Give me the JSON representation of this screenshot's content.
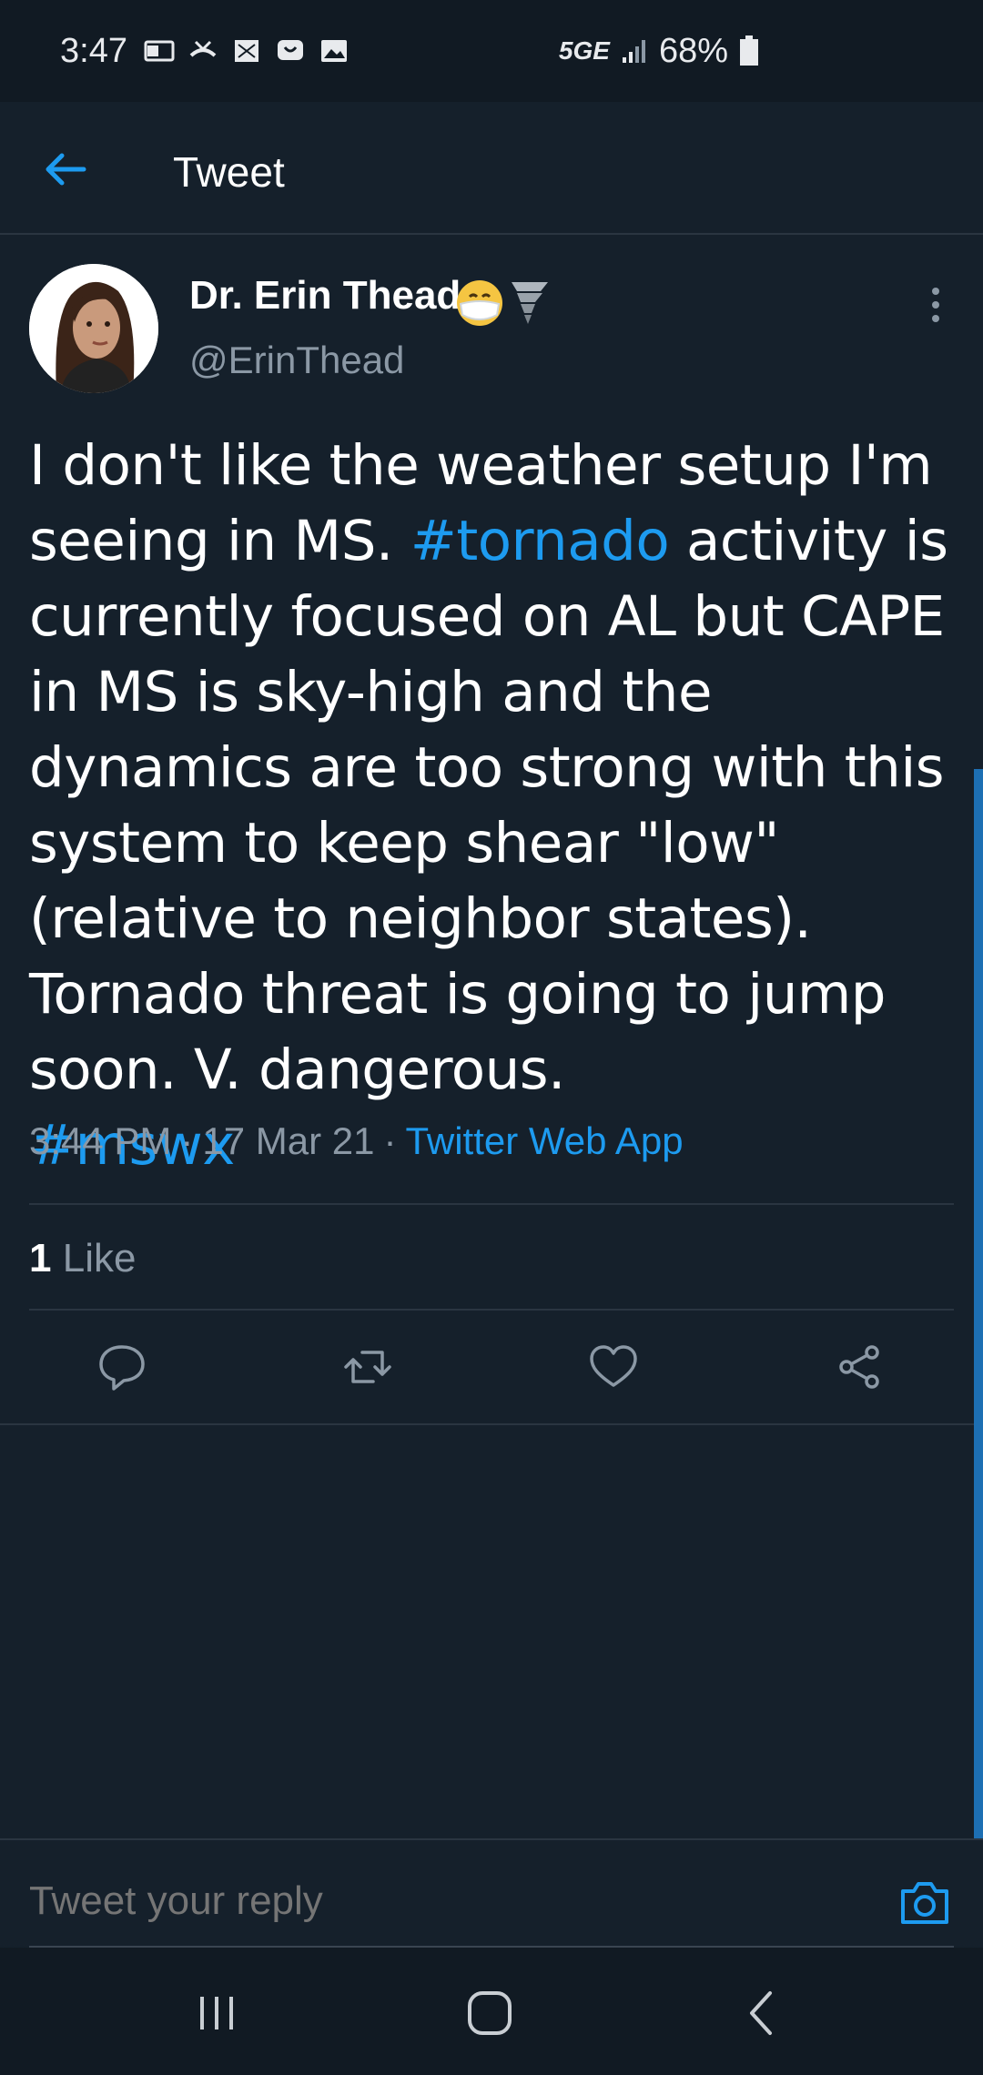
{
  "status_bar": {
    "time": "3:47",
    "network": "5GE",
    "battery": "68%"
  },
  "header": {
    "title": "Tweet"
  },
  "tweet": {
    "display_name": "Dr. Erin Thead",
    "handle": "@ErinThead",
    "text_part1": "I don't like the weather setup I'm seeing in MS. ",
    "hashtag1": "#tornado",
    "text_part2": " activity is currently focused on AL but CAPE in MS is sky-high and the dynamics are too strong with this system to keep shear \"low\" (relative to neighbor states). Tornado threat is going to jump soon. V. dangerous.",
    "hashtag2": "#mswx",
    "time": "3:44 PM",
    "date": "17 Mar 21",
    "separator": "·",
    "source": "Twitter Web App",
    "like_count": "1",
    "like_label": "Like"
  },
  "reply": {
    "placeholder": "Tweet your reply"
  },
  "colors": {
    "background": "#15202b",
    "accent": "#1d9bf0",
    "secondary_text": "#8b98a5"
  }
}
